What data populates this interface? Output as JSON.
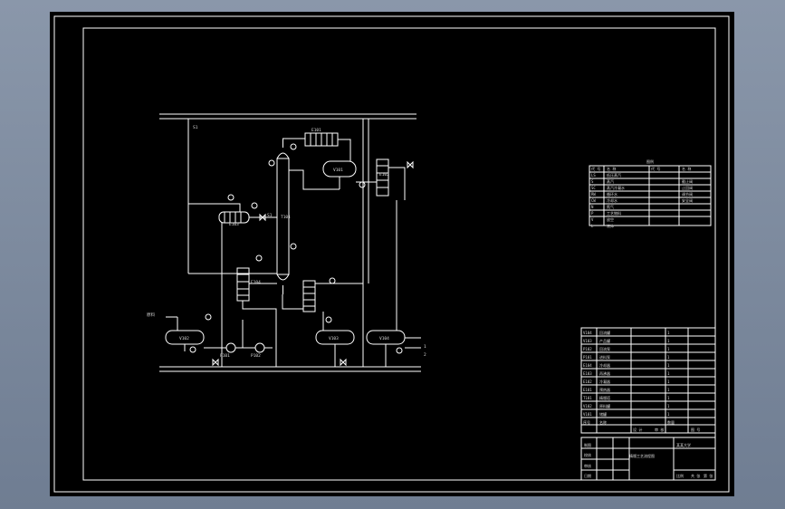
{
  "colors": {
    "viewport_bg": "#7d8aa0",
    "sheet_bg": "#000000",
    "line": "#ffffff",
    "text": "#d8d8d8"
  },
  "process": {
    "col_tag": "T101",
    "hx_top": "E101",
    "drum_top": "V101",
    "cond": "E102",
    "reb1": "E103",
    "reb2": "E104",
    "feed_drum": "V102",
    "drum_mid": "V103",
    "drum_right": "V104",
    "pump1": "P101",
    "pump2": "P102",
    "feed_label": "原料",
    "steam": "S1",
    "valve_label": "S1",
    "label_a": "1",
    "label_b": "2"
  },
  "legend": {
    "title": "图例",
    "rows": [
      [
        "代 号",
        "名 称",
        "代 号",
        "名 称"
      ],
      [
        "LS",
        "低压蒸汽",
        "",
        ""
      ],
      [
        "S",
        "蒸汽",
        "",
        "截止阀"
      ],
      [
        "SC",
        "蒸汽冷凝水",
        "",
        "止回阀"
      ],
      [
        "RW",
        "循环水",
        "",
        "调节阀"
      ],
      [
        "CW",
        "冷却水",
        "",
        "安全阀"
      ],
      [
        "N",
        "氮气",
        "",
        ""
      ],
      [
        "P",
        "工艺物料",
        "",
        ""
      ],
      [
        "V",
        "放空",
        "",
        ""
      ],
      [
        "L",
        "液体",
        "",
        ""
      ]
    ]
  },
  "parts_list": {
    "rows": [
      [
        "V104",
        "回流罐",
        "1"
      ],
      [
        "V103",
        "产品罐",
        "1"
      ],
      [
        "P102",
        "回流泵",
        "1"
      ],
      [
        "P101",
        "进料泵",
        "1"
      ],
      [
        "E104",
        "冷却器",
        "1"
      ],
      [
        "E103",
        "再沸器",
        "1"
      ],
      [
        "E102",
        "冷凝器",
        "1"
      ],
      [
        "E101",
        "预热器",
        "1"
      ],
      [
        "T101",
        "精馏塔",
        "1"
      ],
      [
        "V102",
        "原料罐",
        "1"
      ],
      [
        "V101",
        "储罐",
        "1"
      ],
      [
        "序号",
        "名称",
        "数量"
      ]
    ],
    "footer": [
      "设 计",
      "审 核",
      "图 号"
    ]
  },
  "title_block": {
    "drawing_title": "精馏工艺流程图",
    "school": "某某大学",
    "cells": [
      "制图",
      "校核",
      "审核",
      "日期"
    ],
    "scale_label": "比例",
    "sheet_label": "共 张",
    "sheet_no": "第 张"
  }
}
